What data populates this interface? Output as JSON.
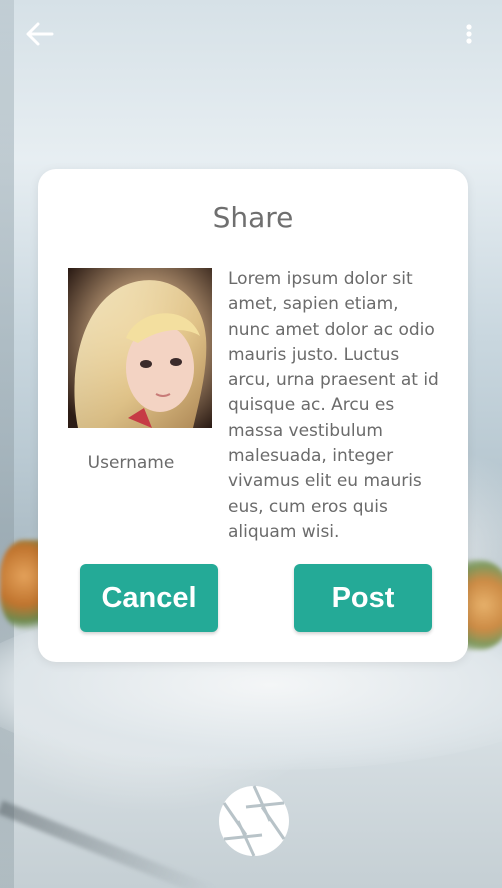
{
  "toolbar": {
    "back_icon": "arrow-left-icon",
    "menu_icon": "more-vert-icon"
  },
  "dialog": {
    "title": "Share",
    "username": "Username",
    "body": "Lorem ipsum dolor sit amet, sapien etiam, nunc amet dolor ac odio mauris justo. Luctus arcu, urna praesent at id quisque ac. Arcu es massa vestibulum malesuada, integer vivamus elit eu mauris eus, cum eros quis aliquam wisi.",
    "cancel_label": "Cancel",
    "post_label": "Post"
  },
  "camera": {
    "shutter_icon": "aperture-icon"
  },
  "colors": {
    "accent": "#24aa97",
    "dialog_bg": "#ffffff",
    "text": "#6b6b6b"
  }
}
